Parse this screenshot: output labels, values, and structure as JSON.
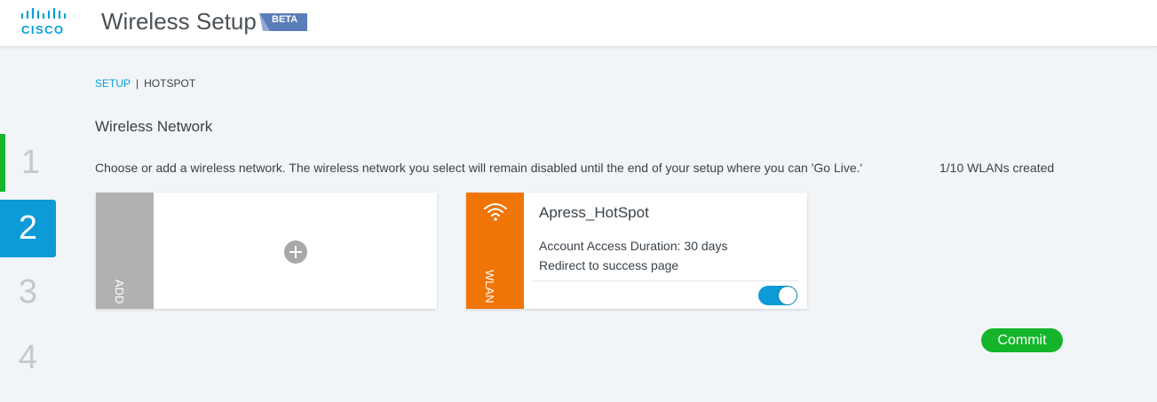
{
  "header": {
    "logo_text": "CISCO",
    "title": "Wireless Setup",
    "beta_label": "BETA"
  },
  "stepper": {
    "steps": [
      {
        "number": "1",
        "state": "completed"
      },
      {
        "number": "2",
        "state": "active"
      },
      {
        "number": "3",
        "state": "pending"
      },
      {
        "number": "4",
        "state": "pending"
      }
    ]
  },
  "breadcrumb": {
    "link": "SETUP",
    "separator": "|",
    "current": "HOTSPOT"
  },
  "section": {
    "title": "Wireless Network",
    "description": "Choose or add a wireless network. The wireless network you select will remain disabled until the end of your setup where you can 'Go Live.'",
    "wlan_count": "1/10 WLANs created"
  },
  "add_card": {
    "strip_label": "ADD",
    "icon": "plus-circle-icon"
  },
  "wlan_card": {
    "strip_label": "WLAN",
    "icon": "wifi-icon",
    "name": "Apress_HotSpot",
    "access_duration": "Account Access Duration: 30 days",
    "redirect": "Redirect to success page",
    "enabled": true
  },
  "actions": {
    "commit_label": "Commit"
  },
  "colors": {
    "brand": "#049fd9",
    "active_step": "#0d9bd7",
    "completed_step": "#14b52a",
    "wlan_strip": "#f07507",
    "add_strip": "#b1b1b1",
    "commit": "#14b52a",
    "toggle_on": "#0d9bd7"
  }
}
